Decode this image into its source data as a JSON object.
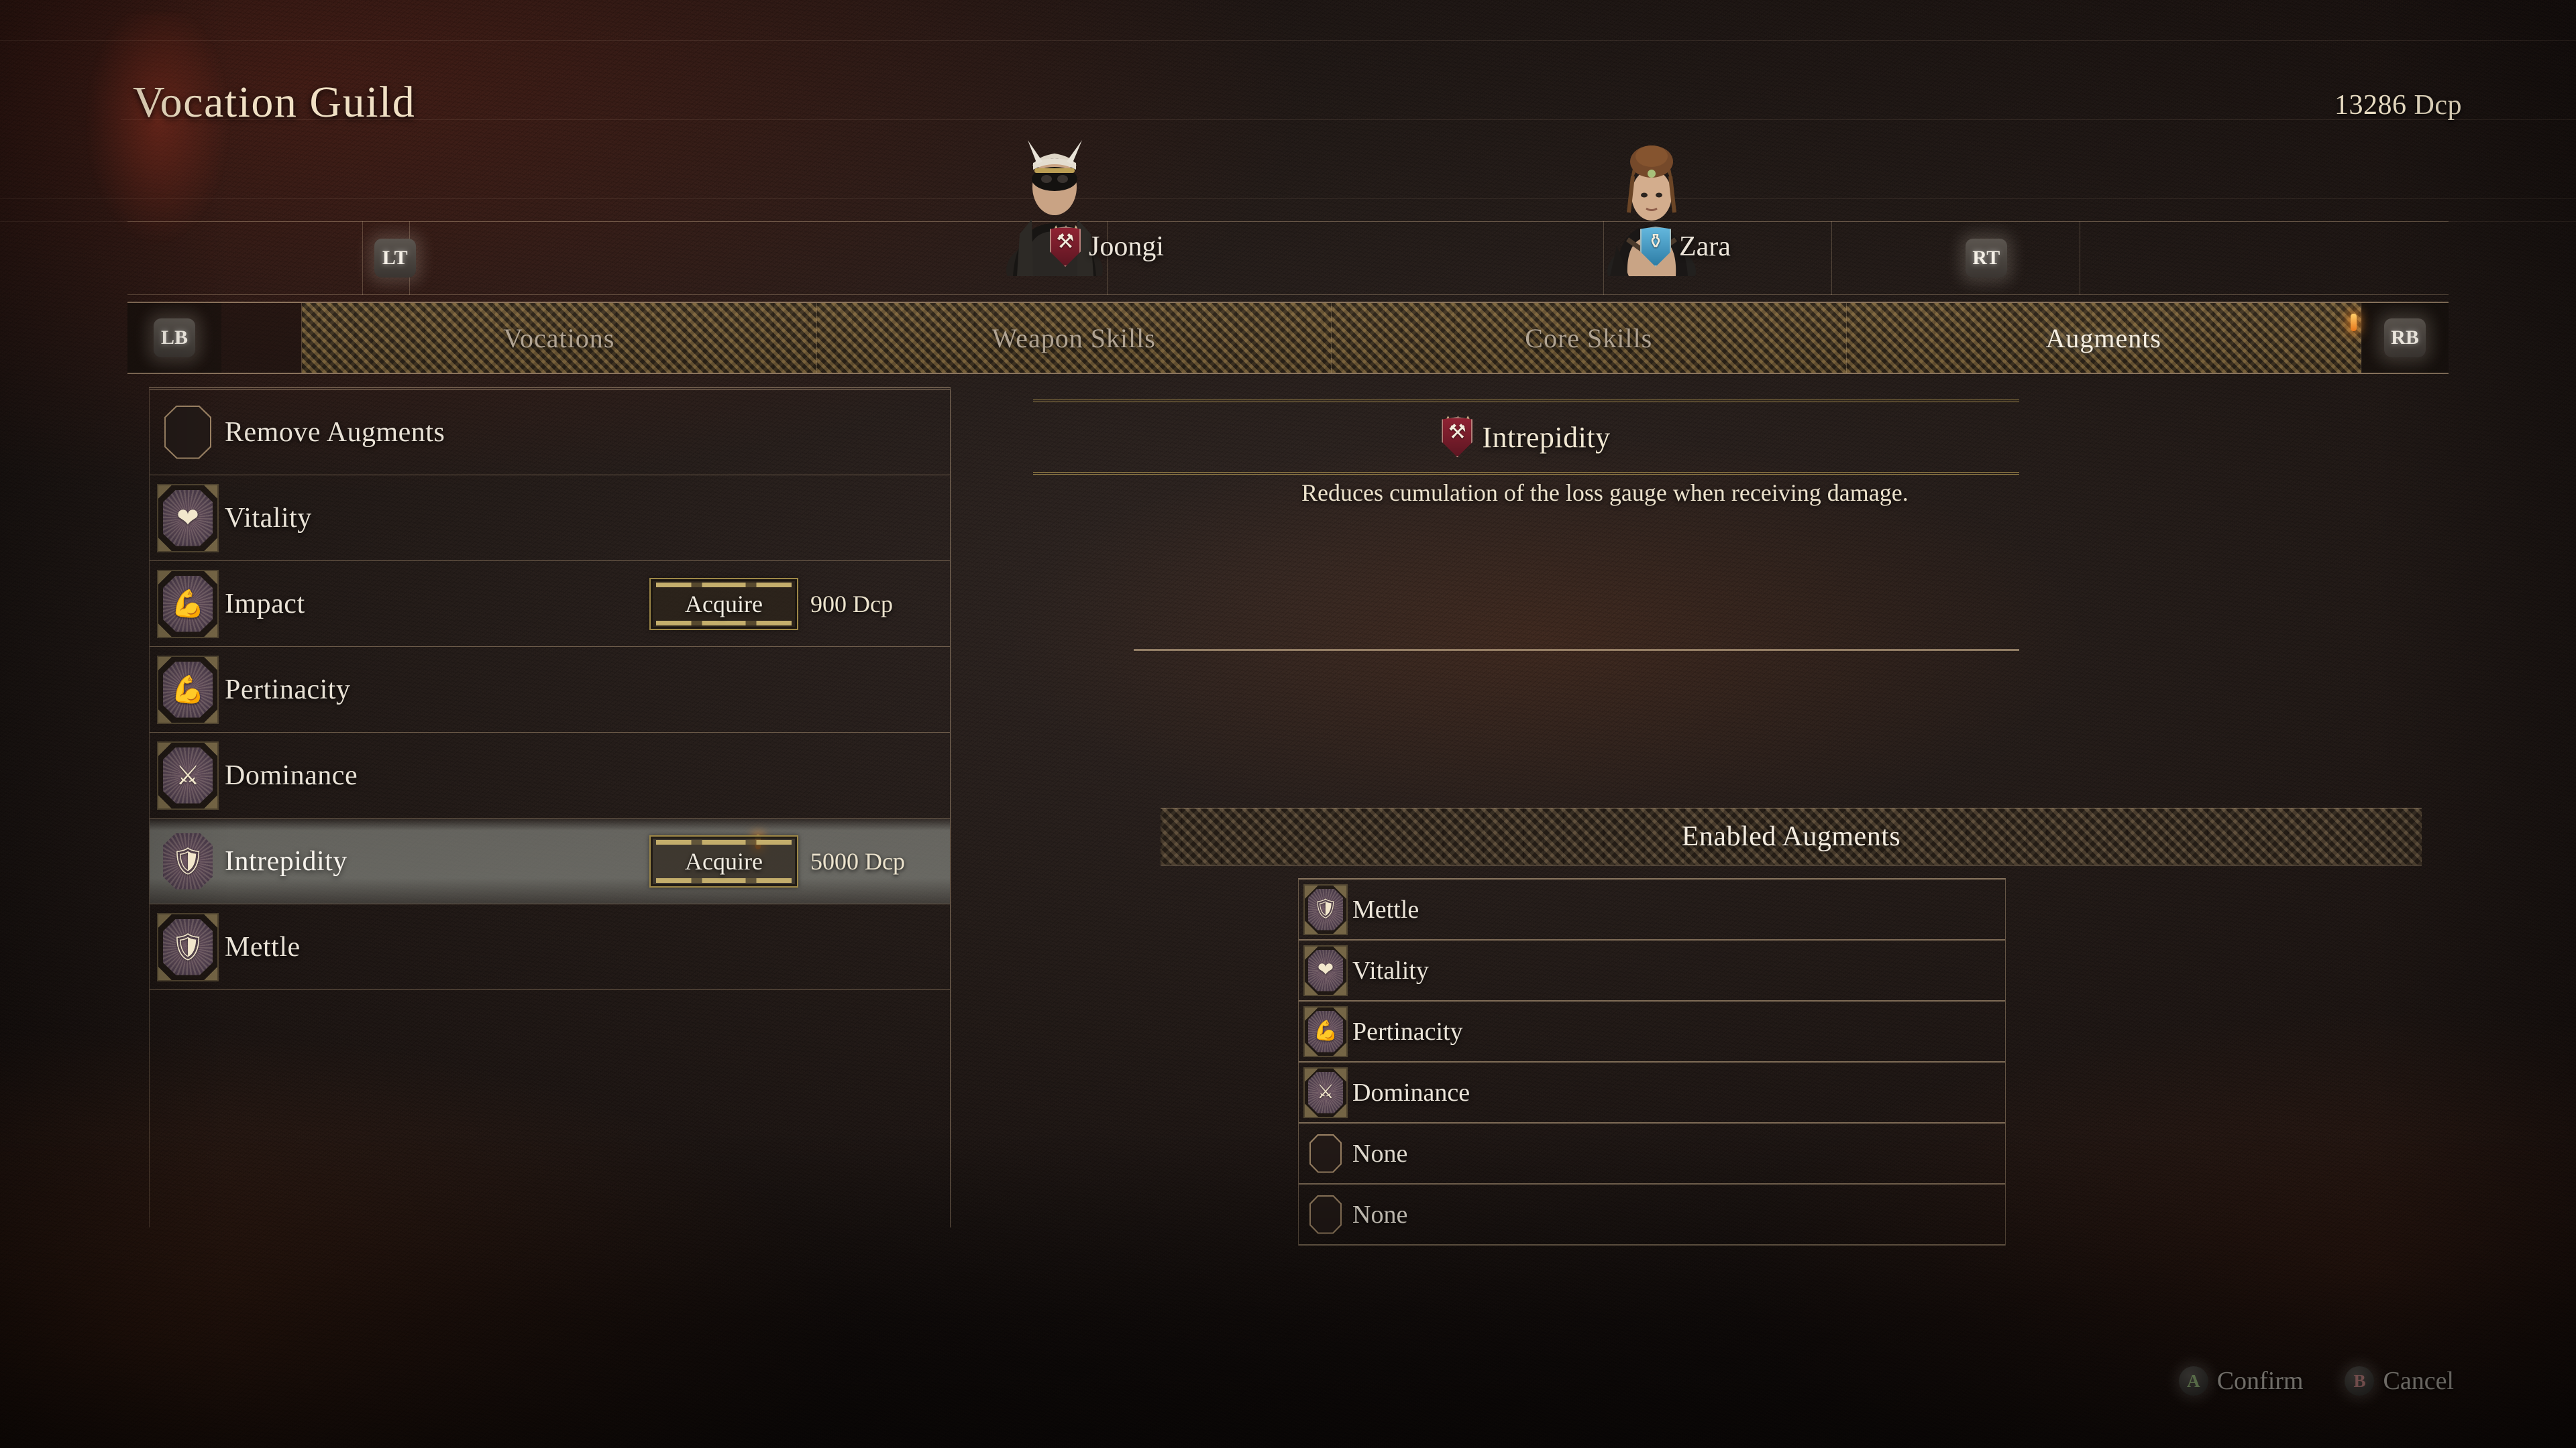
{
  "header": {
    "title": "Vocation Guild",
    "currency": "13286 Dcp"
  },
  "character_bar": {
    "left_trigger": "LT",
    "right_trigger": "RT",
    "characters": [
      {
        "name": "Joongi",
        "badge": "warrior-shield",
        "badge_color": "#8f2333"
      },
      {
        "name": "Zara",
        "badge": "mage-shield",
        "badge_color": "#63b7dd"
      }
    ]
  },
  "tabs": {
    "left_bumper": "LB",
    "right_bumper": "RB",
    "items": [
      {
        "label": "Vocations",
        "active": false
      },
      {
        "label": "Weapon Skills",
        "active": false
      },
      {
        "label": "Core Skills",
        "active": false
      },
      {
        "label": "Augments",
        "active": true
      }
    ],
    "marker_color": "#e8761a"
  },
  "augment_list": [
    {
      "name": "Remove Augments",
      "icon": "empty-octagon",
      "owned": false,
      "selected": false,
      "acquire_label": null,
      "price": null
    },
    {
      "name": "Vitality",
      "icon": "heart-icon",
      "owned": true,
      "selected": false,
      "acquire_label": null,
      "price": null
    },
    {
      "name": "Impact",
      "icon": "raised-arm-icon",
      "owned": true,
      "selected": false,
      "acquire_label": "Acquire",
      "price": "900  Dcp"
    },
    {
      "name": "Pertinacity",
      "icon": "raised-arm-icon",
      "owned": true,
      "selected": false,
      "acquire_label": null,
      "price": null
    },
    {
      "name": "Dominance",
      "icon": "crossed-swords-icon",
      "owned": true,
      "selected": false,
      "acquire_label": null,
      "price": null
    },
    {
      "name": "Intrepidity",
      "icon": "shield-icon",
      "owned": false,
      "selected": true,
      "acquire_label": "Acquire",
      "price": "5000  Dcp"
    },
    {
      "name": "Mettle",
      "icon": "shield-icon",
      "owned": true,
      "selected": false,
      "acquire_label": null,
      "price": null
    }
  ],
  "detail": {
    "name": "Intrepidity",
    "badge": "warrior-shield",
    "description": "Reduces cumulation of the loss gauge when receiving damage."
  },
  "enabled_section": {
    "title": "Enabled Augments",
    "slots": [
      {
        "name": "Mettle",
        "icon": "shield-icon",
        "filled": true
      },
      {
        "name": "Vitality",
        "icon": "heart-icon",
        "filled": true
      },
      {
        "name": "Pertinacity",
        "icon": "raised-arm-icon",
        "filled": true
      },
      {
        "name": "Dominance",
        "icon": "crossed-swords-icon",
        "filled": true
      },
      {
        "name": "None",
        "icon": "empty-octagon",
        "filled": false
      },
      {
        "name": "None",
        "icon": "empty-octagon",
        "filled": false
      }
    ]
  },
  "footer": {
    "confirm_button": "A",
    "confirm_label": "Confirm",
    "cancel_button": "B",
    "cancel_label": "Cancel"
  }
}
